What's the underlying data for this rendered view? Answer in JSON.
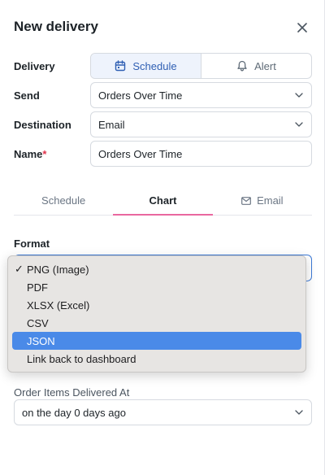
{
  "header": {
    "title": "New delivery"
  },
  "form": {
    "delivery_label": "Delivery",
    "delivery_options": [
      "Schedule",
      "Alert"
    ],
    "send_label": "Send",
    "send_value": "Orders Over Time",
    "destination_label": "Destination",
    "destination_value": "Email",
    "name_label": "Name",
    "name_required_mark": "*",
    "name_value": "Orders Over Time"
  },
  "tabs": [
    "Schedule",
    "Chart",
    "Email"
  ],
  "active_tab": "Chart",
  "format": {
    "label": "Format",
    "options": [
      "PNG (Image)",
      "PDF",
      "XLSX (Excel)",
      "CSV",
      "JSON",
      "Link back to dashboard"
    ],
    "checked": "PNG (Image)",
    "highlighted": "JSON",
    "check_mark": "✓"
  },
  "filter": {
    "label": "Order Items Delivered At",
    "value": "on the day 0 days ago"
  },
  "colors": {
    "accent_blue": "#2f5fb3",
    "tab_underline": "#e9689f",
    "highlight": "#4a8ae8",
    "required": "#e0334c"
  },
  "icons": {
    "close": "close-icon",
    "schedule": "calendar-icon",
    "alert": "bell-icon",
    "email": "envelope-icon",
    "select": "chevron-down-icon"
  }
}
